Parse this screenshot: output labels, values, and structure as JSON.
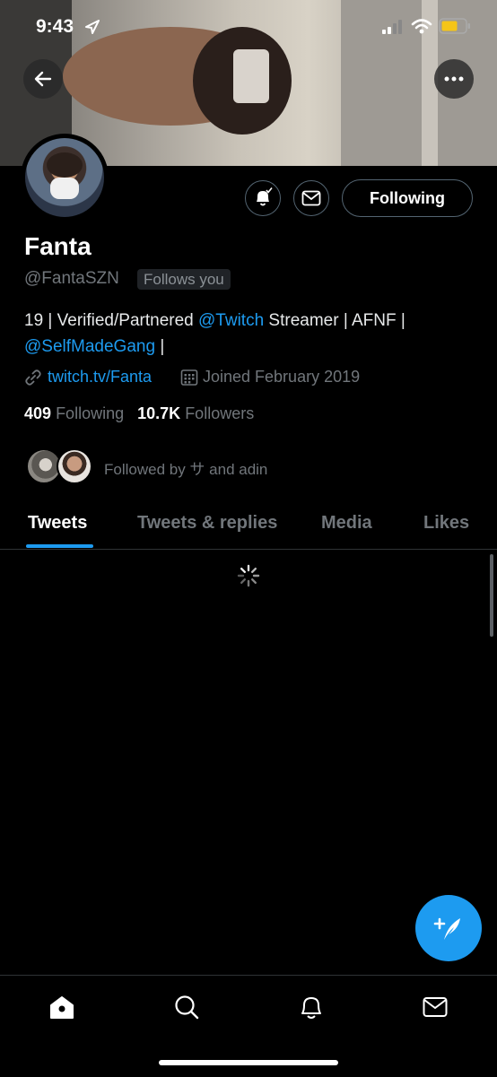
{
  "status_bar": {
    "time": "9:43"
  },
  "profile": {
    "name": "Fanta",
    "handle": "@FantaSZN",
    "follows_you_badge": "Follows you",
    "bio": {
      "part1": "19 | Verified/Partnered ",
      "mention1": "@Twitch",
      "part2": " Streamer | AFNF | ",
      "mention2": "@SelfMadeGang",
      "part3": " |"
    },
    "website": "twitch.tv/Fanta",
    "joined": "Joined February 2019",
    "following_count": "409",
    "following_label": "Following",
    "followers_count": "10.7K",
    "followers_label": "Followers",
    "followed_by": "Followed by サ and adin"
  },
  "actions": {
    "following_button": "Following"
  },
  "tabs": [
    {
      "label": "Tweets",
      "active": true
    },
    {
      "label": "Tweets & replies"
    },
    {
      "label": "Media"
    },
    {
      "label": "Likes"
    }
  ],
  "bottom_nav": [
    "home-icon",
    "search-icon",
    "notifications-icon",
    "messages-icon"
  ],
  "colors": {
    "accent": "#1d9bf0",
    "background": "#000000",
    "muted": "#71767b"
  }
}
